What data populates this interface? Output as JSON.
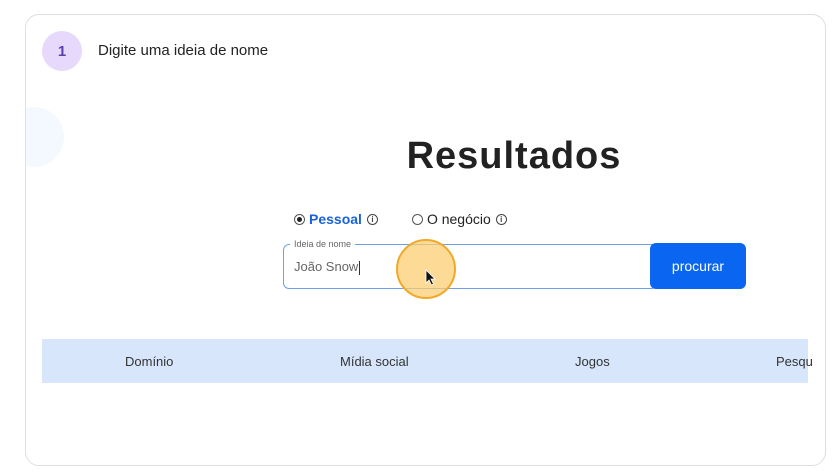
{
  "step": {
    "number": "1",
    "text": "Digite uma ideia de nome"
  },
  "main": {
    "title": "Resultados",
    "radio_options": [
      {
        "label": "Pessoal",
        "checked": true
      },
      {
        "label": "O negócio",
        "checked": false
      }
    ],
    "info_glyph": "i",
    "field": {
      "legend": "Ideia de nome",
      "value": "João Snow"
    },
    "search_label": "procurar"
  },
  "categories": [
    "Domínio",
    "Mídia social",
    "Jogos",
    "Pesqu"
  ],
  "colors": {
    "accent": "#0a66f0",
    "active_radio": "#1a62d6",
    "category_bar": "#d7e6fb",
    "step_badge": "#e6d9fb",
    "click_halo": "#fccd6e"
  },
  "icons": [
    "radio-checked-icon",
    "radio-unchecked-icon",
    "info-icon",
    "mouse-cursor-icon"
  ]
}
